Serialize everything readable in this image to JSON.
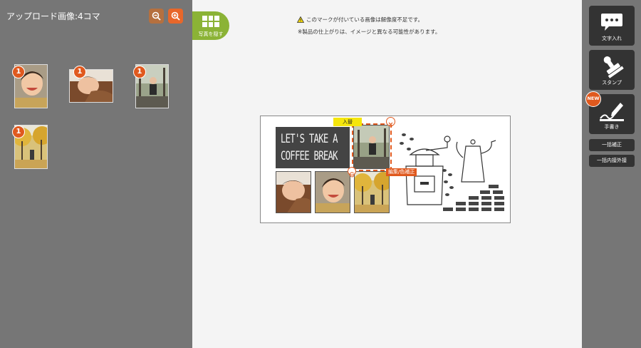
{
  "left_panel": {
    "title": "アップロード画像:4コマ",
    "thumbnails": [
      {
        "badge": "1"
      },
      {
        "badge": "1"
      },
      {
        "badge": "1"
      },
      {
        "badge": "1"
      }
    ]
  },
  "toggle": {
    "label": "写真を隠す"
  },
  "notes": {
    "resolution_warning": "このマークが付いている画像は解像度不足です。",
    "disclaimer": "※製品の仕上がりは、イメージと異なる可能性があります。"
  },
  "product": {
    "text_line1": "LET'S TAKE A",
    "text_line2": "COFFEE BREAK",
    "replace_label": "入替",
    "edit_label": "編集/色補正"
  },
  "toolbar": {
    "text_button": "文字入れ",
    "stamp_button": "スタンプ",
    "new_badge": "NEW",
    "handwrite_button": "手書き",
    "bulk_correct": "一括補正",
    "bulk_fit": "一括内接外接"
  },
  "icons": {
    "zoom_out": "zoom-out-icon",
    "zoom_in": "zoom-in-icon",
    "grid": "grid-icon",
    "warning": "warning-icon",
    "speech": "speech-bubble-icon",
    "stamp": "stamp-icon",
    "pen": "pen-icon",
    "close": "close-icon",
    "rotate": "rotate-icon"
  },
  "colors": {
    "accent_orange": "#e0591e",
    "toggle_green": "#8bb336",
    "replace_yellow": "#f5e60c",
    "panel_gray": "#767676",
    "button_dark": "#333333"
  }
}
